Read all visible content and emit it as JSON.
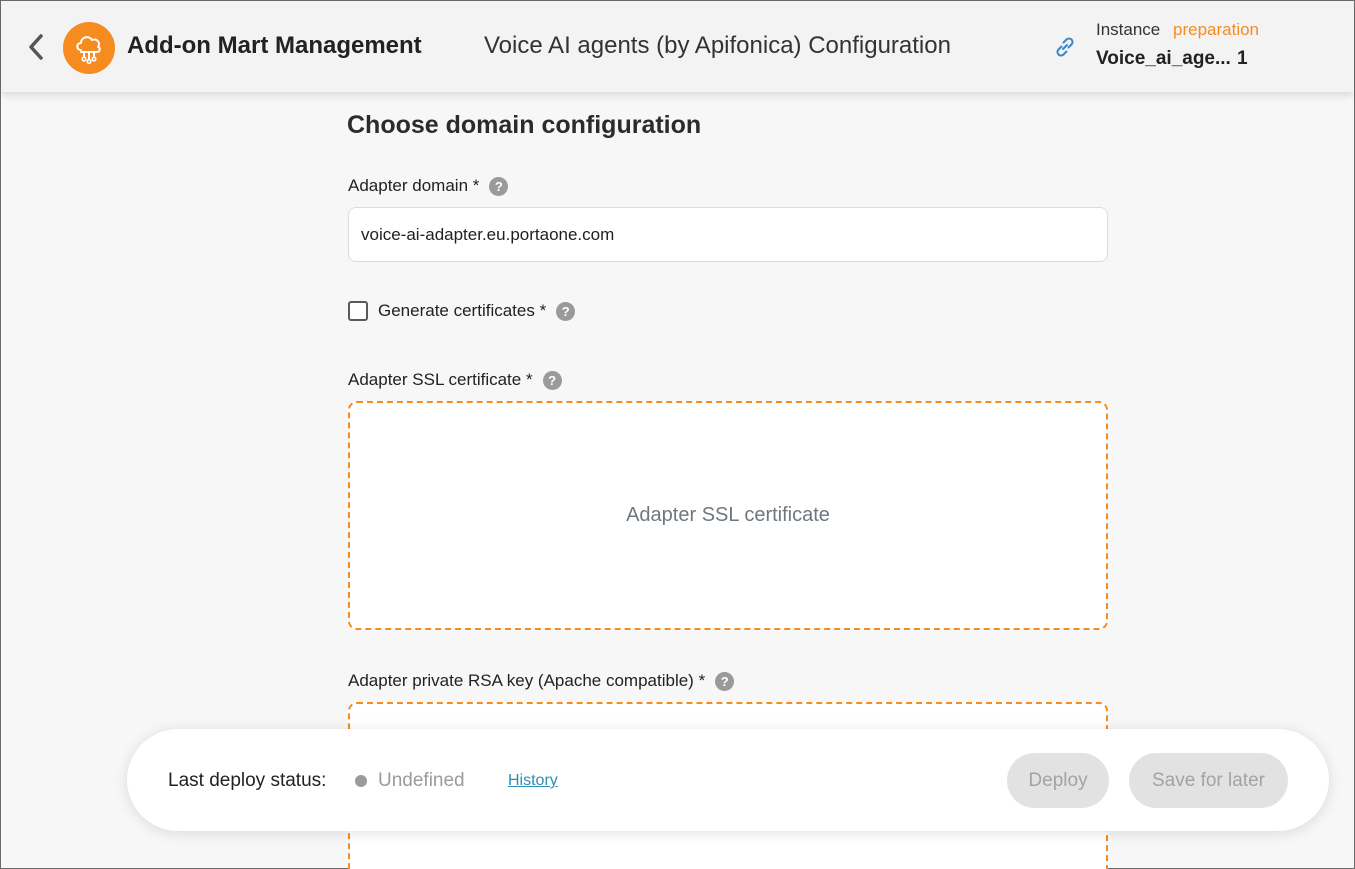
{
  "header": {
    "back_icon": "chevron-left-icon",
    "logo_icon": "cloud-network-icon",
    "logo_color": "#f68b1f",
    "app_title": "Add-on Mart Management",
    "page_subtitle": "Voice AI agents (by Apifonica) Configuration",
    "link_icon": "link-icon",
    "instance_label": "Instance",
    "instance_status": "preparation",
    "instance_name": "Voice_ai_age...",
    "instance_count": "1"
  },
  "form": {
    "section_title": "Choose domain configuration",
    "adapter_domain": {
      "label": "Adapter domain *",
      "value": "voice-ai-adapter.eu.portaone.com"
    },
    "generate_certificates": {
      "label": "Generate certificates *",
      "checked": false
    },
    "ssl_certificate": {
      "label": "Adapter SSL certificate *",
      "placeholder": "Adapter SSL certificate"
    },
    "rsa_key": {
      "label": "Adapter private RSA key (Apache compatible) *"
    },
    "help_glyph": "?"
  },
  "footer": {
    "deploy_status_label": "Last deploy status:",
    "deploy_status_value": "Undefined",
    "history_link": "History",
    "deploy_button": "Deploy",
    "save_button": "Save for later"
  }
}
